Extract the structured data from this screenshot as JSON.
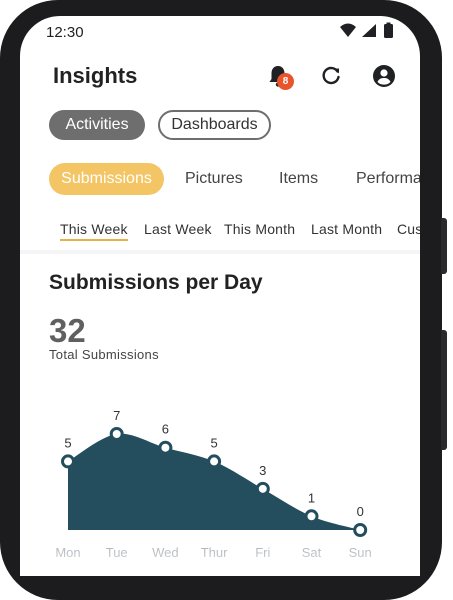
{
  "status_bar": {
    "time": "12:30"
  },
  "header": {
    "title": "Insights",
    "notification_count": "8"
  },
  "view_toggle": [
    {
      "label": "Activities",
      "active": true
    },
    {
      "label": "Dashboards",
      "active": false
    }
  ],
  "category_tabs": [
    {
      "label": "Submissions",
      "active": true
    },
    {
      "label": "Pictures",
      "active": false
    },
    {
      "label": "Items",
      "active": false
    },
    {
      "label": "Performa",
      "active": false
    }
  ],
  "date_ranges": [
    {
      "label": "This Week",
      "active": true
    },
    {
      "label": "Last Week",
      "active": false
    },
    {
      "label": "This Month",
      "active": false
    },
    {
      "label": "Last Month",
      "active": false
    },
    {
      "label": "Cus",
      "active": false
    }
  ],
  "card": {
    "title": "Submissions per Day",
    "total": "32",
    "total_label": "Total Submissions"
  },
  "chart_data": {
    "type": "area",
    "categories": [
      "Mon",
      "Tue",
      "Wed",
      "Thur",
      "Fri",
      "Sat",
      "Sun"
    ],
    "values": [
      5,
      7,
      6,
      5,
      3,
      1,
      0
    ],
    "ylim": [
      0,
      7
    ],
    "grid": false,
    "color": "#244e5e"
  },
  "colors": {
    "accent": "#f4c564",
    "active_pill": "#6e6e6e",
    "badge": "#e8542c",
    "chart_fill": "#244e5e"
  }
}
